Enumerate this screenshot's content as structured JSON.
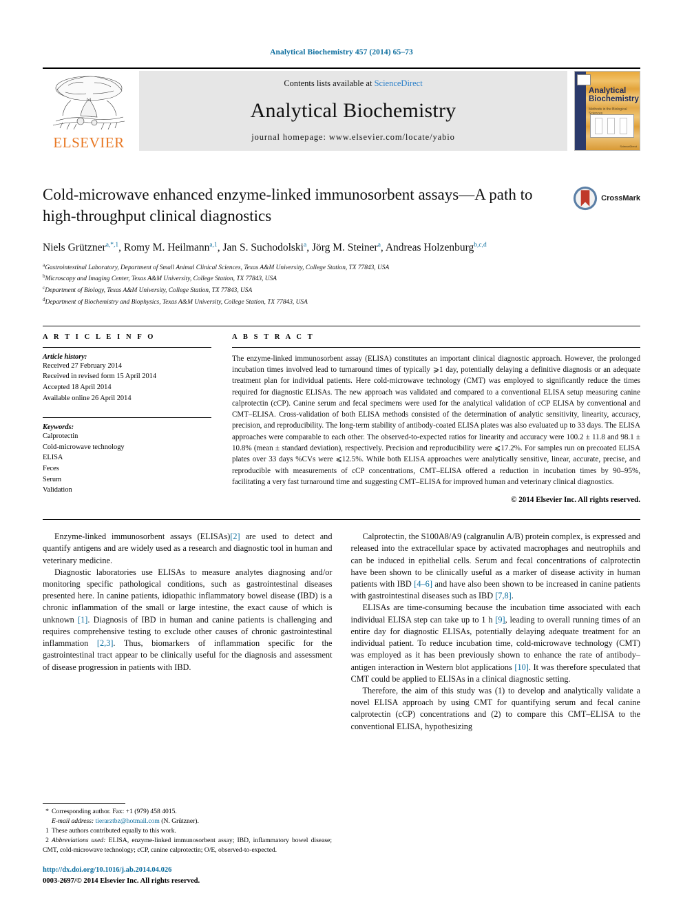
{
  "running_head": "Analytical Biochemistry 457 (2014) 65–73",
  "masthead": {
    "publisher_name": "ELSEVIER",
    "contents_prefix": "Contents lists available at ",
    "contents_link": "ScienceDirect",
    "journal_title": "Analytical Biochemistry",
    "homepage_label": "journal homepage: www.elsevier.com/locate/yabio",
    "cover": {
      "title_line1": "Analytical",
      "title_line2": "Biochemistry",
      "subtitle": "Methods in the Biological Sciences",
      "footer": "ScienceDirect"
    }
  },
  "article": {
    "title": "Cold-microwave enhanced enzyme-linked immunosorbent assays—A path to high-throughput clinical diagnostics",
    "crossmark_label": "CrossMark",
    "authors": [
      {
        "name": "Niels Grützner",
        "sup": "a,*,1"
      },
      {
        "name": "Romy M. Heilmann",
        "sup": "a,1"
      },
      {
        "name": "Jan S. Suchodolski",
        "sup": "a"
      },
      {
        "name": "Jörg M. Steiner",
        "sup": "a"
      },
      {
        "name": "Andreas Holzenburg",
        "sup": "b,c,d"
      }
    ],
    "affiliations": [
      {
        "label": "a",
        "text": "Gastrointestinal Laboratory, Department of Small Animal Clinical Sciences, Texas A&M University, College Station, TX 77843, USA"
      },
      {
        "label": "b",
        "text": "Microscopy and Imaging Center, Texas A&M University, College Station, TX 77843, USA"
      },
      {
        "label": "c",
        "text": "Department of Biology, Texas A&M University, College Station, TX 77843, USA"
      },
      {
        "label": "d",
        "text": "Department of Biochemistry and Biophysics, Texas A&M University, College Station, TX 77843, USA"
      }
    ]
  },
  "article_info": {
    "heading": "A R T I C L E   I N F O",
    "history_label": "Article history:",
    "history": [
      "Received 27 February 2014",
      "Received in revised form 15 April 2014",
      "Accepted 18 April 2014",
      "Available online 26 April 2014"
    ],
    "keywords_label": "Keywords:",
    "keywords": [
      "Calprotectin",
      "Cold-microwave technology",
      "ELISA",
      "Feces",
      "Serum",
      "Validation"
    ]
  },
  "abstract": {
    "heading": "A B S T R A C T",
    "text": "The enzyme-linked immunosorbent assay (ELISA) constitutes an important clinical diagnostic approach. However, the prolonged incubation times involved lead to turnaround times of typically ⩾1 day, potentially delaying a definitive diagnosis or an adequate treatment plan for individual patients. Here cold-microwave technology (CMT) was employed to significantly reduce the times required for diagnostic ELISAs. The new approach was validated and compared to a conventional ELISA setup measuring canine calprotectin (cCP). Canine serum and fecal specimens were used for the analytical validation of cCP ELISA by conventional and CMT–ELISA. Cross-validation of both ELISA methods consisted of the determination of analytic sensitivity, linearity, accuracy, precision, and reproducibility. The long-term stability of antibody-coated ELISA plates was also evaluated up to 33 days. The ELISA approaches were comparable to each other. The observed-to-expected ratios for linearity and accuracy were 100.2 ± 11.8 and 98.1 ± 10.8% (mean ± standard deviation), respectively. Precision and reproducibility were ⩽17.2%. For samples run on precoated ELISA plates over 33 days %CVs were ⩽12.5%. While both ELISA approaches were analytically sensitive, linear, accurate, precise, and reproducible with measurements of cCP concentrations, CMT–ELISA offered a reduction in incubation times by 90–95%, facilitating a very fast turnaround time and suggesting CMT–ELISA for improved human and veterinary clinical diagnostics.",
    "copyright": "© 2014 Elsevier Inc. All rights reserved."
  },
  "body": {
    "left": [
      "Enzyme-linked immunosorbent assays (ELISAs)[2] are used to detect and quantify antigens and are widely used as a research and diagnostic tool in human and veterinary medicine.",
      "Diagnostic laboratories use ELISAs to measure analytes diagnosing and/or monitoring specific pathological conditions, such as gastrointestinal diseases presented here. In canine patients, idiopathic inflammatory bowel disease (IBD) is a chronic inflammation of the small or large intestine, the exact cause of which is unknown [1]. Diagnosis of IBD in human and canine patients is challenging and requires comprehensive testing to exclude other causes of chronic gastrointestinal inflammation [2,3]. Thus, biomarkers of inflammation specific for the gastrointestinal tract appear to be clinically useful for the diagnosis and assessment of disease progression in patients with IBD."
    ],
    "right": [
      "Calprotectin, the S100A8/A9 (calgranulin A/B) protein complex, is expressed and released into the extracellular space by activated macrophages and neutrophils and can be induced in epithelial cells. Serum and fecal concentrations of calprotectin have been shown to be clinically useful as a marker of disease activity in human patients with IBD [4–6] and have also been shown to be increased in canine patients with gastrointestinal diseases such as IBD [7,8].",
      "ELISAs are time-consuming because the incubation time associated with each individual ELISA step can take up to 1 h [9], leading to overall running times of an entire day for diagnostic ELISAs, potentially delaying adequate treatment for an individual patient. To reduce incubation time, cold-microwave technology (CMT) was employed as it has been previously shown to enhance the rate of antibody–antigen interaction in Western blot applications [10]. It was therefore speculated that CMT could be applied to ELISAs in a clinical diagnostic setting.",
      "Therefore, the aim of this study was (1) to develop and analytically validate a novel ELISA approach by using CMT for quantifying serum and fecal canine calprotectin (cCP) concentrations and (2) to compare this CMT–ELISA to the conventional ELISA, hypothesizing"
    ]
  },
  "footnotes": {
    "corresponding": "Corresponding author. Fax: +1 (979) 458 4015.",
    "email_label": "E-mail address:",
    "email": "tierarztbz@hotmail.com",
    "email_suffix": "(N. Grützner).",
    "equal_contribution": "These authors contributed equally to this work.",
    "abbrev_label": "Abbreviations used:",
    "abbrev_text": "ELISA, enzyme-linked immunosorbent assay; IBD, inflammatory bowel disease; CMT, cold-microwave technology; cCP, canine calprotectin; O/E, observed-to-expected.",
    "doi": "http://dx.doi.org/10.1016/j.ab.2014.04.026",
    "issn": "0003-2697/© 2014 Elsevier Inc. All rights reserved."
  },
  "colors": {
    "link_blue": "#0b6d9e",
    "sciencedirect_blue": "#2a7fc9",
    "elsevier_orange": "#e87722",
    "masthead_gray": "#e6e6e6"
  }
}
